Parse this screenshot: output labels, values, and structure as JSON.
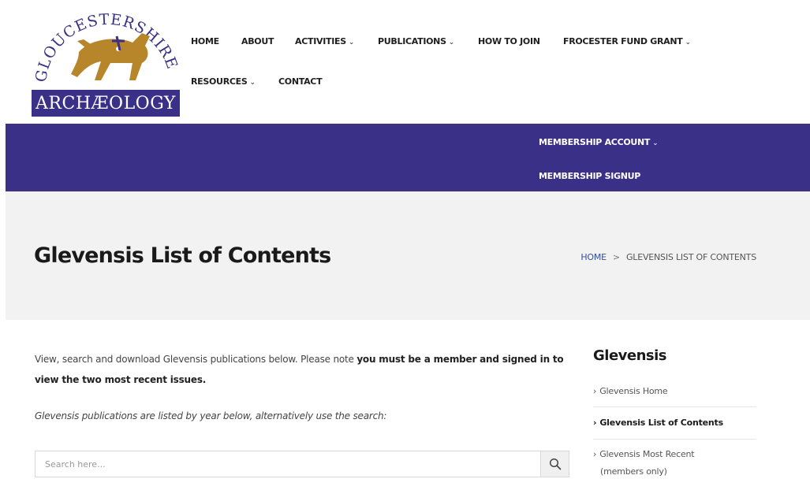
{
  "logo": {
    "top_text": "GLOUCESTERSHIRE",
    "bottom_text": "ARCHÆOLOGY"
  },
  "nav": {
    "items": [
      {
        "label": "HOME",
        "has_dropdown": false
      },
      {
        "label": "ABOUT",
        "has_dropdown": false
      },
      {
        "label": "ACTIVITIES",
        "has_dropdown": true
      },
      {
        "label": "PUBLICATIONS",
        "has_dropdown": true
      },
      {
        "label": "HOW TO JOIN",
        "has_dropdown": false
      },
      {
        "label": "FROCESTER FUND GRANT",
        "has_dropdown": true
      },
      {
        "label": "RESOURCES",
        "has_dropdown": true
      },
      {
        "label": "CONTACT",
        "has_dropdown": false
      }
    ],
    "chevron": "⌄"
  },
  "membership": {
    "account_label": "MEMBERSHIP ACCOUNT",
    "signup_label": "MEMBERSHIP SIGNUP"
  },
  "banner": {
    "title": "Glevensis List of Contents",
    "breadcrumb_home": "HOME",
    "breadcrumb_sep": ">",
    "breadcrumb_current": "GLEVENSIS LIST OF CONTENTS"
  },
  "content": {
    "intro_plain": "View, search and download Glevensis publications below. Please note ",
    "intro_bold": "you must be a member and signed in to view the two most recent issues.",
    "listed_note": "Glevensis publications are listed by year below, alternatively use the search:",
    "search_placeholder": "Search here..."
  },
  "sidebar": {
    "title": "Glevensis",
    "items": [
      {
        "label": "Glevensis Home",
        "active": false
      },
      {
        "label": "Glevensis List of Contents",
        "active": true
      },
      {
        "label": "Glevensis Most Recent",
        "active": false
      },
      {
        "label": "(members only)",
        "active": false
      }
    ],
    "arrow": "›"
  },
  "colors": {
    "brand_purple": "#3a3087",
    "logo_gold": "#b8862a",
    "breadcrumb_link": "#2f4fa0",
    "banner_bg": "#f2f2f2"
  }
}
